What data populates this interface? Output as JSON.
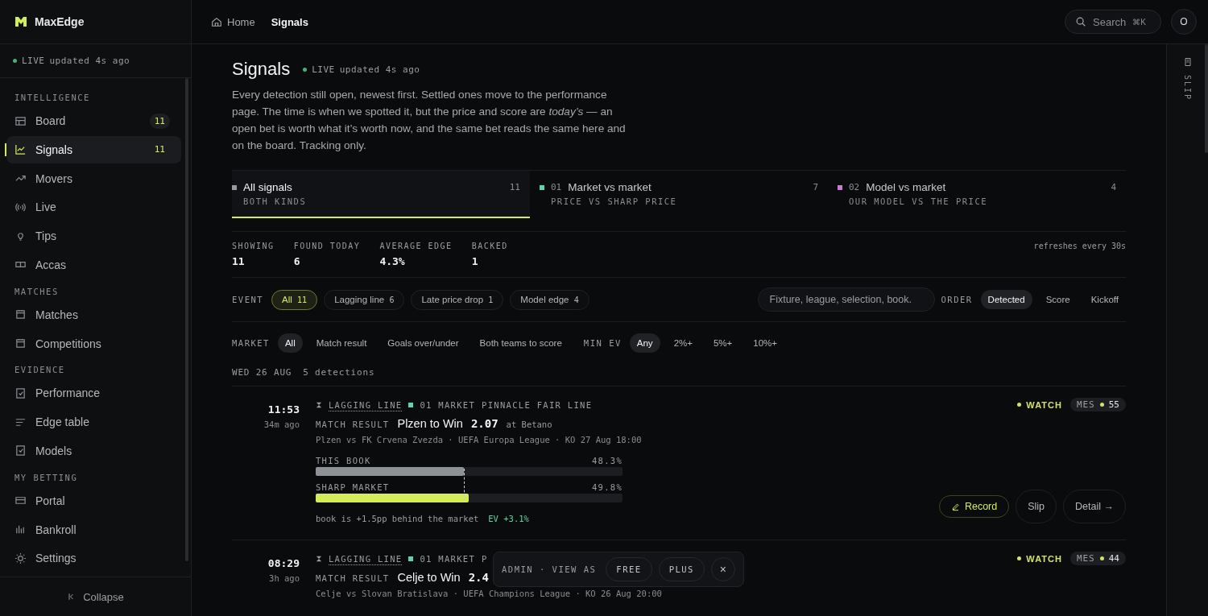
{
  "brand": {
    "name": "MaxEdge"
  },
  "sidebar": {
    "status": {
      "label": "LIVE",
      "text": "updated 4s ago"
    },
    "sections": [
      {
        "title": "INTELLIGENCE",
        "items": [
          {
            "label": "Board",
            "count": "11",
            "selected": false
          },
          {
            "label": "Signals",
            "count": "11",
            "selected": true
          },
          {
            "label": "Movers",
            "selected": false
          },
          {
            "label": "Live",
            "selected": false
          },
          {
            "label": "Tips",
            "selected": false
          },
          {
            "label": "Accas",
            "selected": false
          }
        ]
      },
      {
        "title": "MATCHES",
        "items": [
          {
            "label": "Matches",
            "selected": false
          },
          {
            "label": "Competitions",
            "selected": false
          }
        ]
      },
      {
        "title": "EVIDENCE",
        "items": [
          {
            "label": "Performance",
            "selected": false
          },
          {
            "label": "Edge table",
            "selected": false
          },
          {
            "label": "Models",
            "selected": false
          }
        ]
      },
      {
        "title": "MY BETTING",
        "items": [
          {
            "label": "Portal",
            "selected": false
          },
          {
            "label": "Bankroll",
            "selected": false
          },
          {
            "label": "Settings",
            "selected": false
          }
        ]
      }
    ],
    "collapse": "Collapse"
  },
  "topbar": {
    "breadcrumbs": [
      {
        "label": "Home",
        "selected": false
      },
      {
        "label": "Signals",
        "selected": true
      }
    ],
    "search": {
      "label": "Search",
      "shortcut": "⌘K"
    },
    "avatar": "O"
  },
  "header": {
    "title": "Signals",
    "live": {
      "label": "LIVE",
      "text": "updated 4s ago"
    },
    "description": "Every detection still open, newest first. Settled ones move to the performance page. The time is when we spotted it, but the price and score are *today’s* — an open bet is worth what it’s worth now, and the same bet reads the same here and on the board. Tracking only."
  },
  "tabs": [
    {
      "label": "All signals",
      "sub": "BOTH KINDS",
      "count": "11",
      "color": "#9a9a9a",
      "selected": true
    },
    {
      "number": "01",
      "label": "Market vs market",
      "sub": "PRICE VS SHARP PRICE",
      "count": "7",
      "color": "#5fd3b0",
      "selected": false
    },
    {
      "number": "02",
      "label": "Model vs market",
      "sub": "OUR MODEL VS THE PRICE",
      "count": "4",
      "color": "#c77dd1",
      "selected": false
    }
  ],
  "stats": [
    {
      "label": "SHOWING",
      "value": "11"
    },
    {
      "label": "FOUND TODAY",
      "value": "6"
    },
    {
      "label": "AVERAGE EDGE",
      "value": "4.3%"
    },
    {
      "label": "BACKED",
      "value": "1"
    }
  ],
  "refresh": "refreshes every 30s",
  "event_filter": {
    "label": "EVENT",
    "chips": [
      {
        "label": "All",
        "count": "11",
        "selected": true
      },
      {
        "label": "Lagging line",
        "count": "6",
        "selected": false
      },
      {
        "label": "Late price drop",
        "count": "1",
        "selected": false
      },
      {
        "label": "Model edge",
        "count": "4",
        "selected": false
      }
    ]
  },
  "filter_search": {
    "placeholder": "Fixture, league, selection, book."
  },
  "order": {
    "label": "ORDER",
    "options": [
      {
        "label": "Detected",
        "selected": true
      },
      {
        "label": "Score",
        "selected": false
      },
      {
        "label": "Kickoff",
        "selected": false
      }
    ]
  },
  "market_filter": {
    "label": "MARKET",
    "options": [
      {
        "label": "All",
        "selected": true
      },
      {
        "label": "Match result",
        "selected": false
      },
      {
        "label": "Goals over/under",
        "selected": false
      },
      {
        "label": "Both teams to score",
        "selected": false
      }
    ]
  },
  "min_ev": {
    "label": "MIN EV",
    "options": [
      {
        "label": "Any",
        "selected": true
      },
      {
        "label": "2%+",
        "selected": false
      },
      {
        "label": "5%+",
        "selected": false
      },
      {
        "label": "10%+",
        "selected": false
      }
    ]
  },
  "day": {
    "date": "WED 26 AUG",
    "count": "5 detections"
  },
  "signals": [
    {
      "time": "11:53",
      "ago": "34m ago",
      "type": "LAGGING LINE",
      "color": "#5fd3b0",
      "kind": "01 MARKET",
      "source": "PINNACLE FAIR LINE",
      "market": "MATCH RESULT",
      "selection": "Plzen to Win",
      "price": "2.07",
      "book": "at Betano",
      "fixture": "Plzen vs FK Crvena Zvezda · UEFA Europa League · KO 27 Aug 18:00",
      "bars": [
        {
          "label": "THIS BOOK",
          "value": "48.3%",
          "level": 0.483,
          "kind": "book"
        },
        {
          "label": "SHARP MARKET",
          "value": "49.8%",
          "level": 0.498,
          "kind": "sharp"
        }
      ],
      "note": "book is +1.5pp behind the market",
      "ev": "EV +3.1%",
      "status": "WATCH",
      "score": {
        "label": "MES",
        "value": "55"
      },
      "actions": [
        {
          "label": "Record",
          "kind": "record"
        },
        {
          "label": "Slip",
          "kind": "plain"
        },
        {
          "label": "Detail →",
          "kind": "plain"
        }
      ]
    },
    {
      "time": "08:29",
      "ago": "3h ago",
      "type": "LAGGING LINE",
      "color": "#5fd3b0",
      "kind": "01 MARKET",
      "source": "P",
      "market": "MATCH RESULT",
      "selection": "Celje to Win",
      "price": "2.4",
      "fixture": "Celje vs Slovan Bratislava · UEFA Champions League · KO 26 Aug 20:00",
      "status": "WATCH",
      "score": {
        "label": "MES",
        "value": "44"
      }
    }
  ],
  "admin_bar": {
    "label": "ADMIN · VIEW AS",
    "options": [
      "FREE",
      "PLUS"
    ],
    "close": "×"
  },
  "rail": {
    "label": "SLIP"
  }
}
